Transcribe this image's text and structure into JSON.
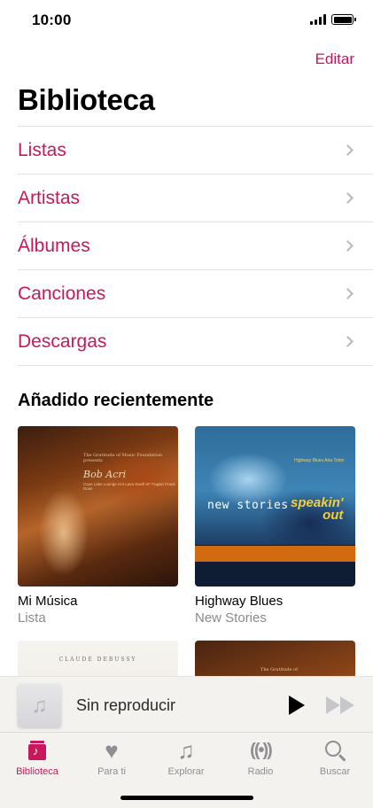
{
  "status_bar": {
    "time": "10:00"
  },
  "header": {
    "edit_label": "Editar",
    "title": "Biblioteca"
  },
  "menu": {
    "items": [
      {
        "label": "Listas"
      },
      {
        "label": "Artistas"
      },
      {
        "label": "Álbumes"
      },
      {
        "label": "Canciones"
      },
      {
        "label": "Descargas"
      }
    ]
  },
  "recent": {
    "title": "Añadido recientemente",
    "cards": [
      {
        "title": "Mi Música",
        "subtitle": "Lista",
        "art": {
          "line1": "The Gratitude of Music Foundation presents",
          "name": "Bob Acri",
          "line2": "Cave Lake Lounge Hot Lava Swell SF Fugain Frank Rose"
        }
      },
      {
        "title": "Highway Blues",
        "subtitle": "New Stories",
        "art": {
          "top": "Highway Blues Aria Tolon",
          "left": "new stories",
          "right1": "speakin'",
          "right2": "out"
        }
      },
      {
        "art": {
          "text": "CLAUDE DEBUSSY"
        }
      },
      {
        "art": {
          "text": "The Gratitude of"
        }
      }
    ]
  },
  "mini_player": {
    "title": "Sin reproducir"
  },
  "tabs": [
    {
      "label": "Biblioteca",
      "icon": "library-icon",
      "active": true
    },
    {
      "label": "Para ti",
      "icon": "heart-icon",
      "active": false
    },
    {
      "label": "Explorar",
      "icon": "music-note-icon",
      "active": false
    },
    {
      "label": "Radio",
      "icon": "radio-icon",
      "active": false
    },
    {
      "label": "Buscar",
      "icon": "search-icon",
      "active": false
    }
  ],
  "colors": {
    "accent": "#c8185b",
    "tab_inactive": "#8e8e93"
  }
}
